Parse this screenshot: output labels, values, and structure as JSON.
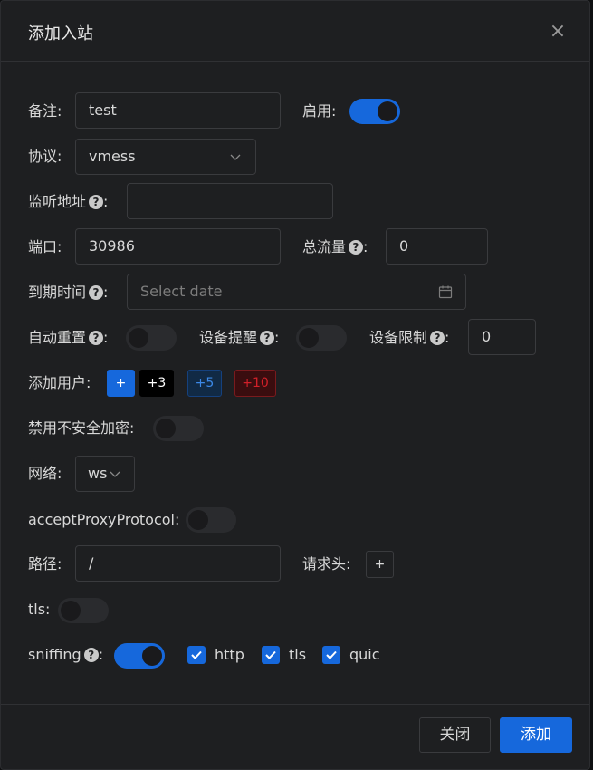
{
  "dialog": {
    "title": "添加入站",
    "close_glyph": "×"
  },
  "form": {
    "remark": {
      "label": "备注:",
      "value": "test"
    },
    "enable": {
      "label": "启用:",
      "on": true
    },
    "protocol": {
      "label": "协议:",
      "value": "vmess"
    },
    "listen": {
      "label": "监听地址",
      "suffix": ":",
      "value": ""
    },
    "port": {
      "label": "端口:",
      "value": "30986"
    },
    "total_traffic": {
      "label": "总流量",
      "suffix": ":",
      "value": "0"
    },
    "expiry": {
      "label": "到期时间",
      "suffix": ":",
      "placeholder": "Select date"
    },
    "auto_reset": {
      "label": "自动重置",
      "suffix": ":",
      "on": false
    },
    "device_alert": {
      "label": "设备提醒",
      "suffix": ":",
      "on": false
    },
    "device_limit": {
      "label": "设备限制",
      "suffix": ":",
      "value": "0"
    },
    "add_user": {
      "label": "添加用户:",
      "buttons": [
        "+",
        "+3",
        "+5",
        "+10"
      ]
    },
    "disable_insecure": {
      "label": "禁用不安全加密:",
      "on": false
    },
    "network": {
      "label": "网络:",
      "value": "ws"
    },
    "accept_proxy": {
      "label": "acceptProxyProtocol:",
      "on": false
    },
    "path": {
      "label": "路径:",
      "value": "/"
    },
    "headers": {
      "label": "请求头:",
      "add": "+"
    },
    "tls": {
      "label": "tls:",
      "on": false
    },
    "sniffing": {
      "label": "sniffing",
      "suffix": ":",
      "on": true,
      "options": [
        {
          "label": "http",
          "checked": true
        },
        {
          "label": "tls",
          "checked": true
        },
        {
          "label": "quic",
          "checked": true
        }
      ]
    }
  },
  "footer": {
    "close": "关闭",
    "add": "添加"
  },
  "help_glyph": "?",
  "colors": {
    "accent": "#1668dc",
    "background": "#1e1f21",
    "border": "#3a3b3e"
  }
}
